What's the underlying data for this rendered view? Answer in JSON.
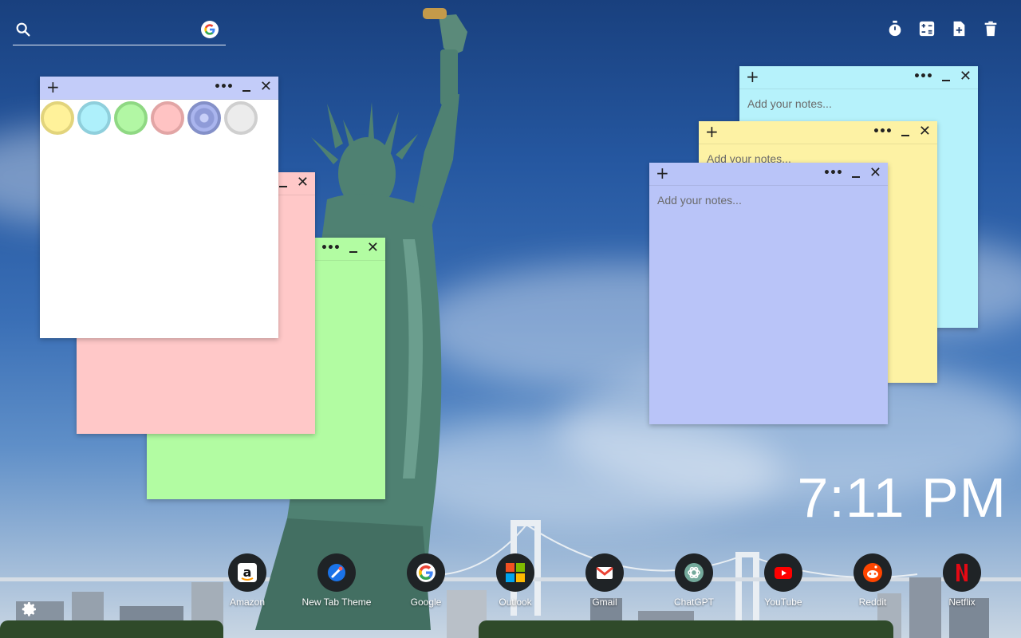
{
  "search": {
    "placeholder": ""
  },
  "tools": [
    "timer-icon",
    "calculator-icon",
    "new-note-icon",
    "trash-icon"
  ],
  "notes_common": {
    "placeholder": "Add your notes..."
  },
  "notes": [
    {
      "id": "blue",
      "color": "#b9c4f8",
      "header": "#c3ccf9"
    },
    {
      "id": "yellow",
      "color": "#fdf2a4",
      "header": "#fdf2a4"
    },
    {
      "id": "cyan",
      "color": "#b6f2fb",
      "header": "#b6f2fb"
    },
    {
      "id": "white",
      "color": "#ffffff",
      "header": "#c3ccf9"
    },
    {
      "id": "pink",
      "color": "#ffc8c8",
      "header": "#ffc8c8"
    },
    {
      "id": "green",
      "color": "#b2fca2",
      "header": "#b2fca2"
    }
  ],
  "palette": [
    {
      "name": "yellow",
      "color": "#fff29a"
    },
    {
      "name": "cyan",
      "color": "#aef0fb"
    },
    {
      "name": "green",
      "color": "#b2f7a4"
    },
    {
      "name": "pink",
      "color": "#ffc3c3"
    },
    {
      "name": "periwinkle",
      "color": "#aab5ee"
    },
    {
      "name": "white",
      "color": "#ececec"
    }
  ],
  "clock": {
    "time": "7:11 PM"
  },
  "dock": [
    {
      "label": "Amazon",
      "icon": "amazon-icon"
    },
    {
      "label": "New Tab Theme",
      "icon": "new-tab-theme-icon"
    },
    {
      "label": "Google",
      "icon": "google-icon"
    },
    {
      "label": "Outlook",
      "icon": "outlook-icon"
    },
    {
      "label": "Gmail",
      "icon": "gmail-icon"
    },
    {
      "label": "ChatGPT",
      "icon": "chatgpt-icon"
    },
    {
      "label": "YouTube",
      "icon": "youtube-icon"
    },
    {
      "label": "Reddit",
      "icon": "reddit-icon"
    },
    {
      "label": "Netflix",
      "icon": "netflix-icon"
    }
  ]
}
